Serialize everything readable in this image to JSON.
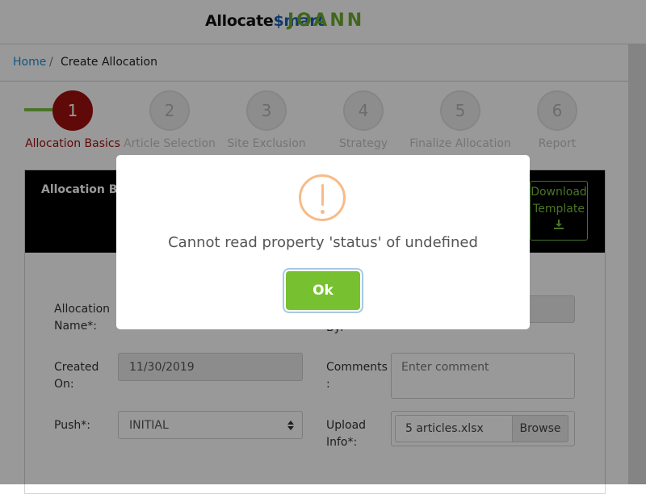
{
  "header": {
    "logo_allocate": "Allocate",
    "logo_dollar": "$",
    "logo_smart": "mart",
    "logo_brand": "JOANN"
  },
  "breadcrumb": {
    "home": "Home",
    "separator": "/",
    "current": "Create Allocation"
  },
  "stepper": {
    "steps": [
      {
        "number": "1",
        "label": "Allocation Basics",
        "active": true
      },
      {
        "number": "2",
        "label": "Article Selection",
        "active": false
      },
      {
        "number": "3",
        "label": "Site Exclusion",
        "active": false
      },
      {
        "number": "4",
        "label": "Strategy",
        "active": false
      },
      {
        "number": "5",
        "label": "Finalize Allocation",
        "active": false
      },
      {
        "number": "6",
        "label": "Report",
        "active": false
      }
    ]
  },
  "panel": {
    "title": "Allocation Bas",
    "download_line1": "Download",
    "download_line2": "Template"
  },
  "form": {
    "allocation_name_label_1": "Allocation",
    "allocation_name_label_2": "Name*:",
    "created_by_label_fragment": "By:",
    "created_on_label_1": "Created",
    "created_on_label_2": "On:",
    "created_on_value": "11/30/2019",
    "comments_label_1": "Comments",
    "comments_label_2": ":",
    "comments_placeholder": "Enter comment",
    "push_label": "Push*:",
    "push_value": "INITIAL",
    "upload_label_1": "Upload",
    "upload_label_2": "Info*:",
    "upload_file": "5 articles.xlsx",
    "browse": "Browse"
  },
  "modal": {
    "message": "Cannot read property 'status' of undefined",
    "ok_label": "Ok",
    "icon": "warning-exclamation-icon"
  },
  "colors": {
    "accent_red": "#a01010",
    "accent_green": "#77c131",
    "warning_orange": "#f8bb86"
  }
}
